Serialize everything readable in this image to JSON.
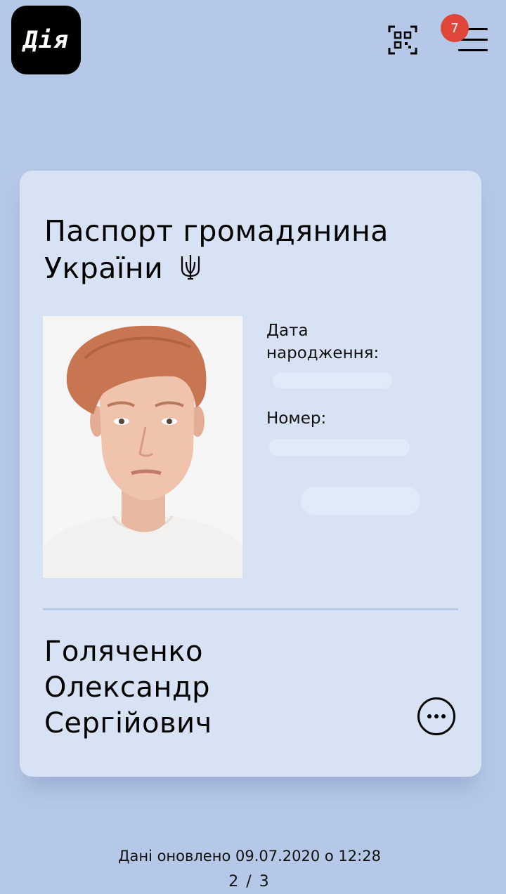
{
  "header": {
    "logo_text": "Дія",
    "qr_icon": "qr-scan-icon",
    "menu_icon": "hamburger-menu-icon",
    "notifications_count": "7",
    "badge_color": "#e0453a"
  },
  "card": {
    "title": "Паспорт громадянина України",
    "emblem_icon": "trident-icon",
    "fields": {
      "birth_date_label": "Дата народження:",
      "number_label": "Номер:"
    },
    "owner": {
      "surname": "Голяченко",
      "given_name": "Олександр",
      "patronymic": "Сергійович"
    },
    "more_icon": "more-options-icon"
  },
  "footer": {
    "updated_text": "Дані оновлено 09.07.2020 о 12:28",
    "pager_text": "2 / 3"
  },
  "colors": {
    "background": "#b5c8e8",
    "card": "#d7e2f4"
  }
}
